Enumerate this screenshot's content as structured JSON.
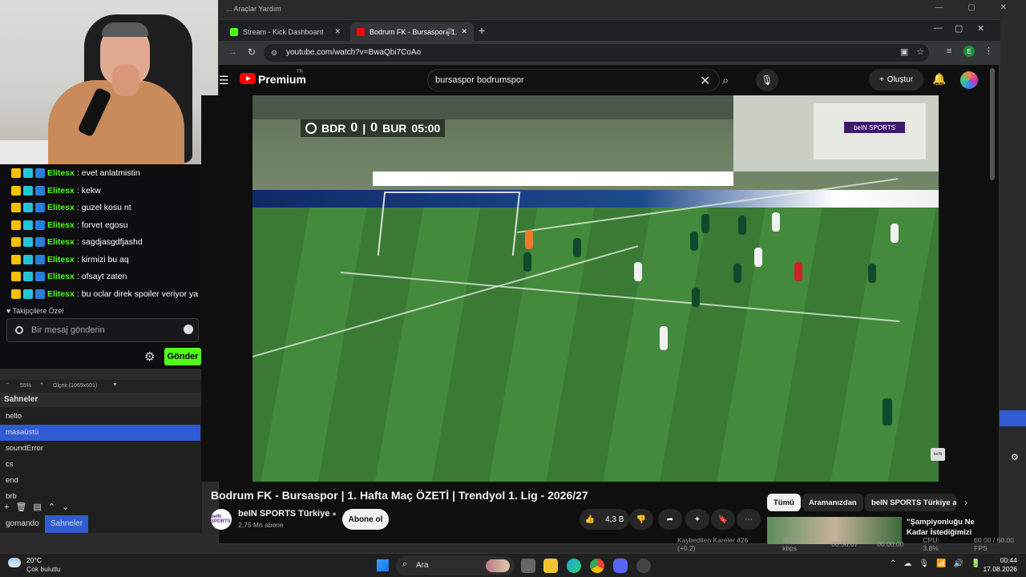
{
  "obs": {
    "menu": "... Araçlar   Yardım",
    "zoom": "55%",
    "scale": "Ölçek (1069x601)",
    "scenes_header": "Sahneler",
    "scenes": [
      "hello",
      "masaüstü",
      "soundError",
      "cs",
      "end",
      "brb"
    ],
    "selected_scene_index": 1,
    "bottom_tabs": [
      "gomando",
      "Sahneler"
    ],
    "status": [
      "Kaybedilen Kareler 426 (+0.2)",
      "8071 kbps",
      "00:56:07",
      "00:00:00",
      "CPU: 3.8%",
      "60.00 / 60.00 FPS"
    ]
  },
  "chat": {
    "messages": [
      {
        "user": "Elitesx",
        "text": "evet anlatmistin"
      },
      {
        "user": "Elitesx",
        "text": "kekw"
      },
      {
        "user": "Elitesx",
        "text": "guzel kosu nt"
      },
      {
        "user": "Elitesx",
        "text": "forvet egosu"
      },
      {
        "user": "Elitesx",
        "text": "sagdjasgdfjashd"
      },
      {
        "user": "Elitesx",
        "text": "kirmizi bu aq"
      },
      {
        "user": "Elitesx",
        "text": "ofsayt zaten"
      },
      {
        "user": "Elitesx",
        "text": "bu oclar direk spoiler veriyor ya"
      }
    ],
    "followers_note": "♥ Takipçilere Özel",
    "input_placeholder": "Bir mesaj gönderin",
    "send_label": "Gönder",
    "colors": {
      "username": "#53fc18",
      "send_button": "#53fc18"
    }
  },
  "browser": {
    "tabs": [
      {
        "title": "Stream - Kick Dashboard",
        "icon": "kick-icon",
        "active": false
      },
      {
        "title": "Bodrum FK - Bursaspor | 1.",
        "icon": "youtube-icon",
        "active": true
      }
    ],
    "url": "youtube.com/watch?v=BwaQbi7CoAo",
    "profile_letter": "E"
  },
  "youtube": {
    "brand": "Premium",
    "region": "TR",
    "search_value": "bursaspor bodrumspor",
    "create_label": "Oluştur",
    "video_title": "Bodrum FK - Bursaspor | 1. Hafta Maç ÖZETİ | Trendyol 1. Lig - 2026/27",
    "channel_name": "beIN SPORTS Türkiye",
    "channel_avatar_text": "beIN SPORTS",
    "subscribers": "2,75 Mn abone",
    "subscribe_label": "Abone ol",
    "likes": "4,3 B",
    "chips": [
      "Tümü",
      "Aramanızdan",
      "beIN SPORTS Türkiye ad"
    ],
    "selected_chip_index": 0,
    "recommendation_title": "\"Şampiyonluğu Ne Kadar İstediğimizi",
    "scoreboard": {
      "home": "BDR",
      "home_score": "0",
      "away_score": "0",
      "away": "BUR",
      "clock": "05:00"
    },
    "broadcaster_badge": "beIN SPORTS",
    "corner_logo": "beIN"
  },
  "taskbar": {
    "temperature": "20°C",
    "weather": "Çok bulutlu",
    "search_label": "Ara",
    "time": "00:44",
    "date": "17.08.2026"
  }
}
